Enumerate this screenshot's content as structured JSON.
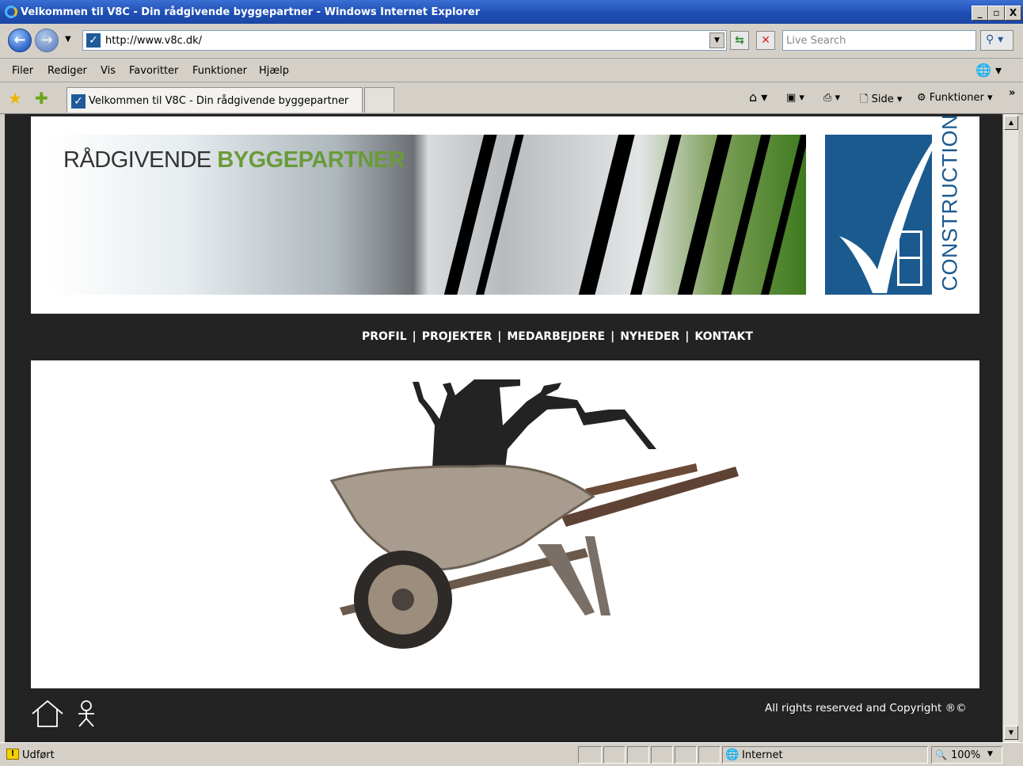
{
  "window": {
    "title": "Velkommen til V8C - Din rådgivende byggepartner - Windows Internet Explorer",
    "controls": {
      "minimize": "_",
      "maximize": "🗗",
      "close": "X"
    }
  },
  "address_bar": {
    "url": "http://www.v8c.dk/",
    "search_placeholder": "Live Search"
  },
  "menu": [
    "Filer",
    "Rediger",
    "Vis",
    "Favoritter",
    "Funktioner",
    "Hjælp"
  ],
  "tab": {
    "title": "Velkommen til V8C - Din rådgivende byggepartner"
  },
  "command_bar": {
    "page_label": "Side",
    "tools_label": "Funktioner"
  },
  "page": {
    "banner_text_1": "RÅDGIVENDE",
    "banner_text_2": "BYGGEPARTNER",
    "logo_text": "CONSTRUCTION",
    "nav": [
      "PROFIL",
      "PROJEKTER",
      "MEDARBEJDERE",
      "NYHEDER",
      "KONTAKT"
    ],
    "nav_separator": "|",
    "copyright": "All rights reserved and Copyright ®©",
    "colors": {
      "background": "#232323",
      "banner_green": "#6a9b3a",
      "logo_blue": "#1b5a8f"
    }
  },
  "status_bar": {
    "status": "Udført",
    "zone": "Internet",
    "zoom": "100%"
  }
}
